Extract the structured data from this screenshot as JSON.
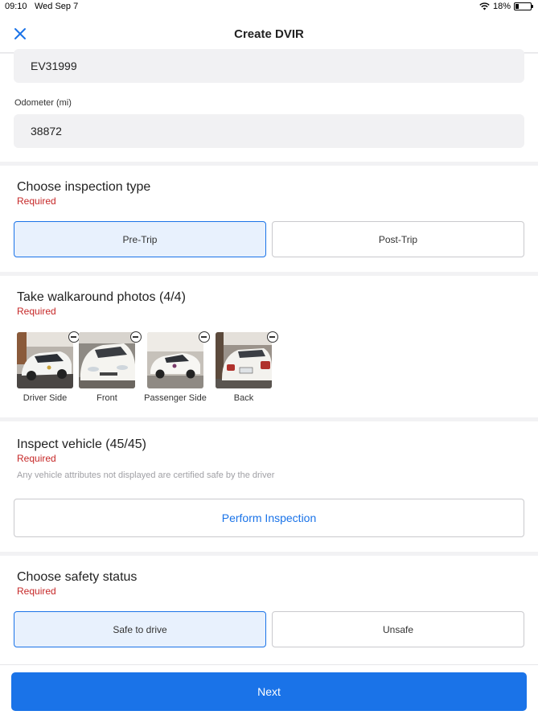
{
  "status_bar": {
    "time": "09:10",
    "date": "Wed Sep 7",
    "battery": "18%"
  },
  "nav": {
    "title": "Create DVIR"
  },
  "vehicle": {
    "vehicle_value": "EV31999",
    "odometer_label": "Odometer (mi)",
    "odometer_value": "38872"
  },
  "inspection_type": {
    "title": "Choose inspection type",
    "required": "Required",
    "options": [
      "Pre-Trip",
      "Post-Trip"
    ],
    "selected": "Pre-Trip"
  },
  "photos": {
    "title": "Take walkaround photos (4/4)",
    "required": "Required",
    "items": [
      "Driver Side",
      "Front",
      "Passenger Side",
      "Back"
    ]
  },
  "inspect": {
    "title": "Inspect vehicle (45/45)",
    "required": "Required",
    "hint": "Any vehicle attributes not displayed are certified safe by the driver",
    "button": "Perform Inspection"
  },
  "safety": {
    "title": "Choose safety status",
    "required": "Required",
    "options": [
      "Safe to drive",
      "Unsafe"
    ],
    "selected": "Safe to drive"
  },
  "footer": {
    "next": "Next"
  },
  "colors": {
    "accent": "#1a73e8",
    "required": "#c62828",
    "selected_bg": "#e8f1fd"
  },
  "icons": {
    "close": "close-icon",
    "wifi": "wifi-icon",
    "battery": "battery-icon",
    "remove": "remove-circle-icon"
  }
}
